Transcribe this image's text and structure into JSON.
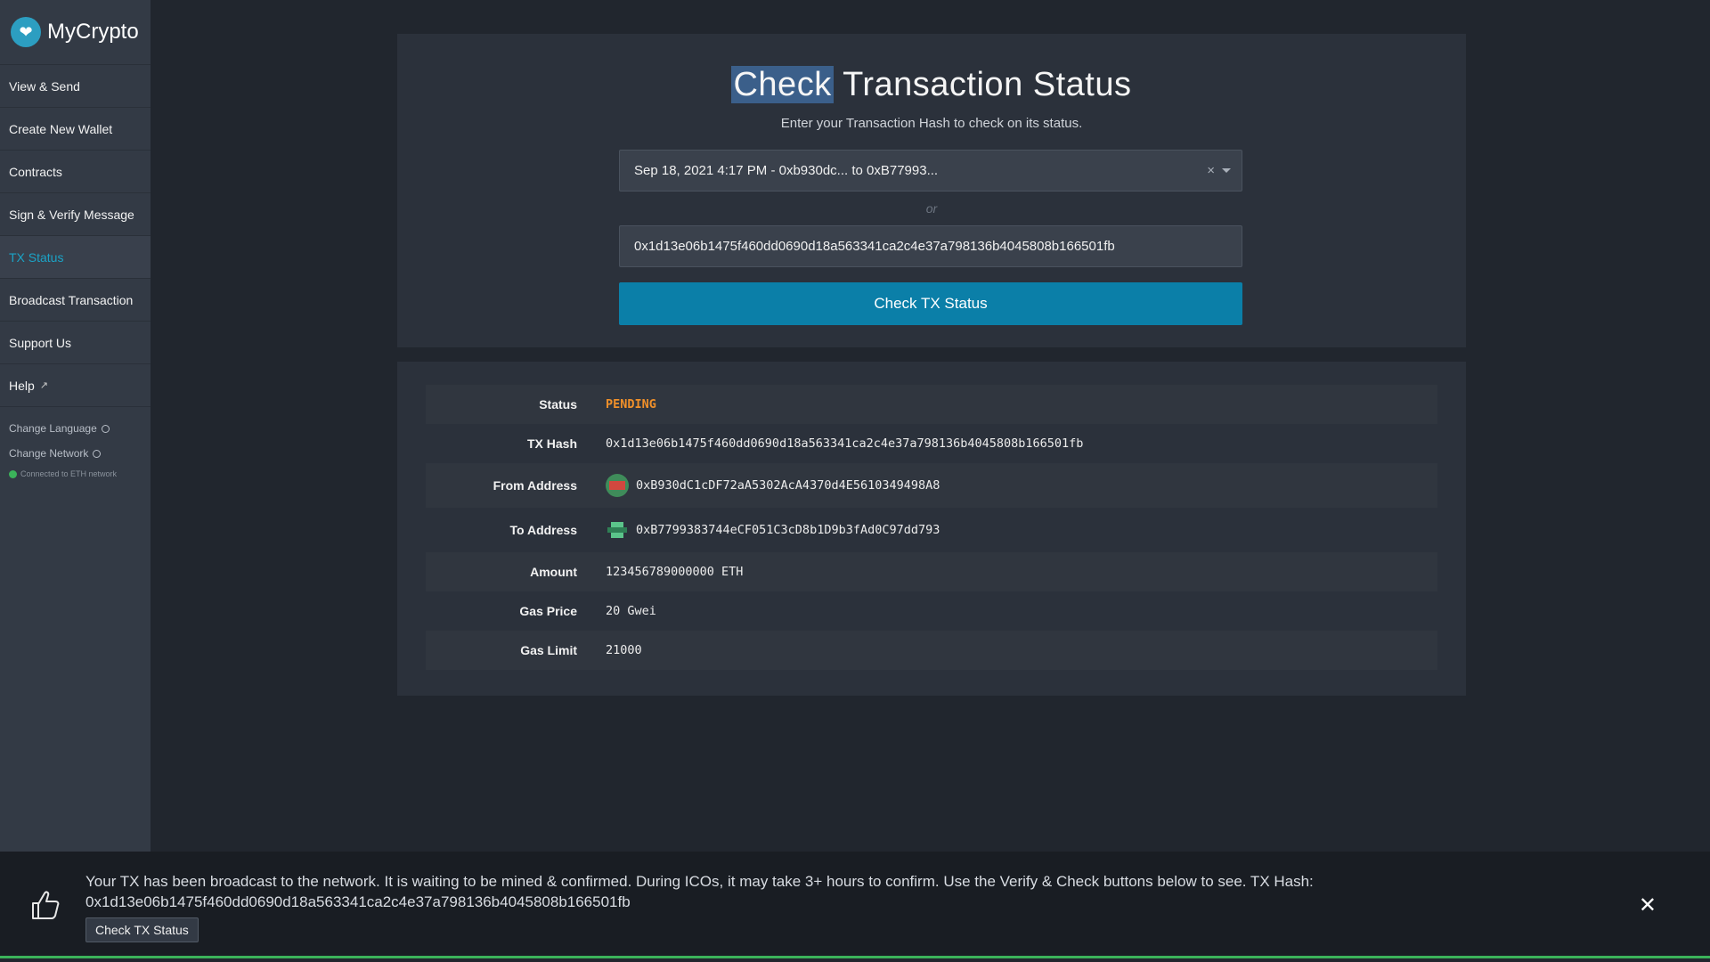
{
  "sidebar": {
    "logo_text": "MyCrypto",
    "items": [
      {
        "label": "View & Send"
      },
      {
        "label": "Create New Wallet"
      },
      {
        "label": "Contracts"
      },
      {
        "label": "Sign & Verify Message"
      },
      {
        "label": "TX Status"
      },
      {
        "label": "Broadcast Transaction"
      },
      {
        "label": "Support Us"
      },
      {
        "label": "Help"
      }
    ],
    "change_language": "Change Language",
    "change_network": "Change Network",
    "connection_status": "Connected to ETH network"
  },
  "header": {
    "title_highlight": "Check",
    "title_rest": " Transaction Status",
    "subtitle": "Enter your Transaction Hash to check on its status."
  },
  "form": {
    "selected_tx": "Sep 18, 2021 4:17 PM - 0xb930dc... to 0xB77993...",
    "clear_glyph": "×",
    "or_label": "or",
    "hash_value": "0x1d13e06b1475f460dd0690d18a563341ca2c4e37a798136b4045808b166501fb",
    "check_button": "Check TX Status"
  },
  "details": {
    "status_label": "Status",
    "status_value": "PENDING",
    "hash_label": "TX Hash",
    "hash_value": "0x1d13e06b1475f460dd0690d18a563341ca2c4e37a798136b4045808b166501fb",
    "from_label": "From Address",
    "from_value": "0xB930dC1cDF72aA5302AcA4370d4E5610349498A8",
    "to_label": "To Address",
    "to_value": "0xB7799383744eCF051C3cD8b1D9b3fAd0C97dd793",
    "amount_label": "Amount",
    "amount_value": "123456789000000 ETH",
    "gas_price_label": "Gas Price",
    "gas_price_value": "20 Gwei",
    "gas_limit_label": "Gas Limit",
    "gas_limit_value": "21000"
  },
  "notice": {
    "line1": "Your TX has been broadcast to the network. It is waiting to be mined & confirmed. During ICOs, it may take 3+ hours to confirm. Use the Verify & Check buttons below to see. TX Hash:",
    "line2": "0x1d13e06b1475f460dd0690d18a563341ca2c4e37a798136b4045808b166501fb",
    "button": "Check TX Status",
    "close_glyph": "✕"
  },
  "colors": {
    "accent": "#0b7fa8",
    "active_nav": "#1ba3c6",
    "pending": "#f0902a",
    "connected": "#3bb35a"
  }
}
